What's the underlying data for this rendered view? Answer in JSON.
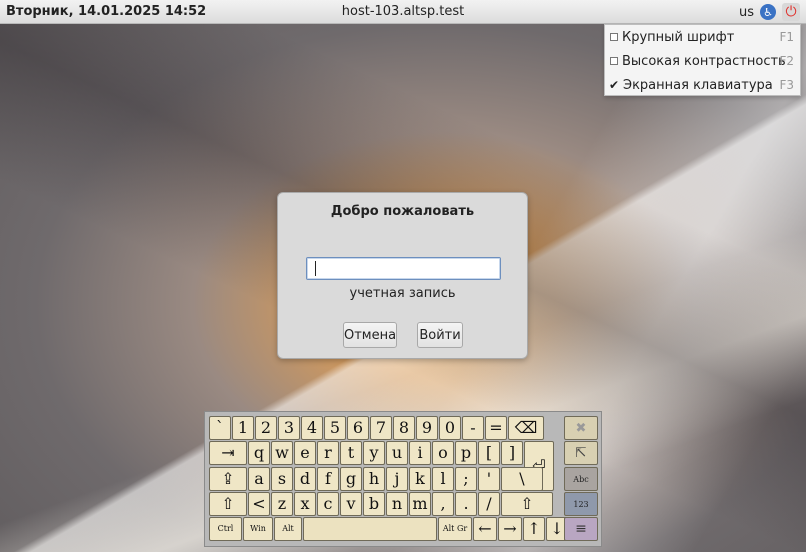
{
  "topbar": {
    "datetime": "Вторник, 14.01.2025 14:52",
    "hostname": "host-103.altsp.test",
    "layout": "us",
    "accessibility_icon": "accessibility-icon",
    "power_icon": "power-icon"
  },
  "accessibility_menu": {
    "items": [
      {
        "label": "Крупный шрифт",
        "shortcut": "F1",
        "checked": false
      },
      {
        "label": "Высокая контрастность",
        "shortcut": "F2",
        "checked": false
      },
      {
        "label": "Экранная клавиатура",
        "shortcut": "F3",
        "checked": true
      }
    ]
  },
  "dialog": {
    "title": "Добро пожаловать",
    "username_value": "",
    "field_label": "учетная запись",
    "cancel_label": "Отмена",
    "login_label": "Войти"
  },
  "keyboard": {
    "rows": [
      [
        "`",
        "1",
        "2",
        "3",
        "4",
        "5",
        "6",
        "7",
        "8",
        "9",
        "0",
        "-",
        "=",
        "⌫"
      ],
      [
        "⇥",
        "q",
        "w",
        "e",
        "r",
        "t",
        "y",
        "u",
        "i",
        "o",
        "p",
        "[",
        "]",
        "⏎"
      ],
      [
        "⇪",
        "a",
        "s",
        "d",
        "f",
        "g",
        "h",
        "j",
        "k",
        "l",
        ";",
        "'",
        "\\"
      ],
      [
        "⇧",
        "<",
        "z",
        "x",
        "c",
        "v",
        "b",
        "n",
        "m",
        ",",
        ".",
        "/",
        "⇧"
      ],
      [
        "Ctrl",
        "Win",
        "Alt",
        "",
        "Alt Gr",
        "←",
        "→",
        "↑",
        "↓"
      ]
    ],
    "side": [
      "✖",
      "⇱",
      "Abc",
      "123",
      "≡"
    ]
  },
  "colors": {
    "key_face": "#efe6c6",
    "dialog_bg": "#dadada",
    "power": "#e0322e",
    "accessibility": "#3a72c4"
  }
}
